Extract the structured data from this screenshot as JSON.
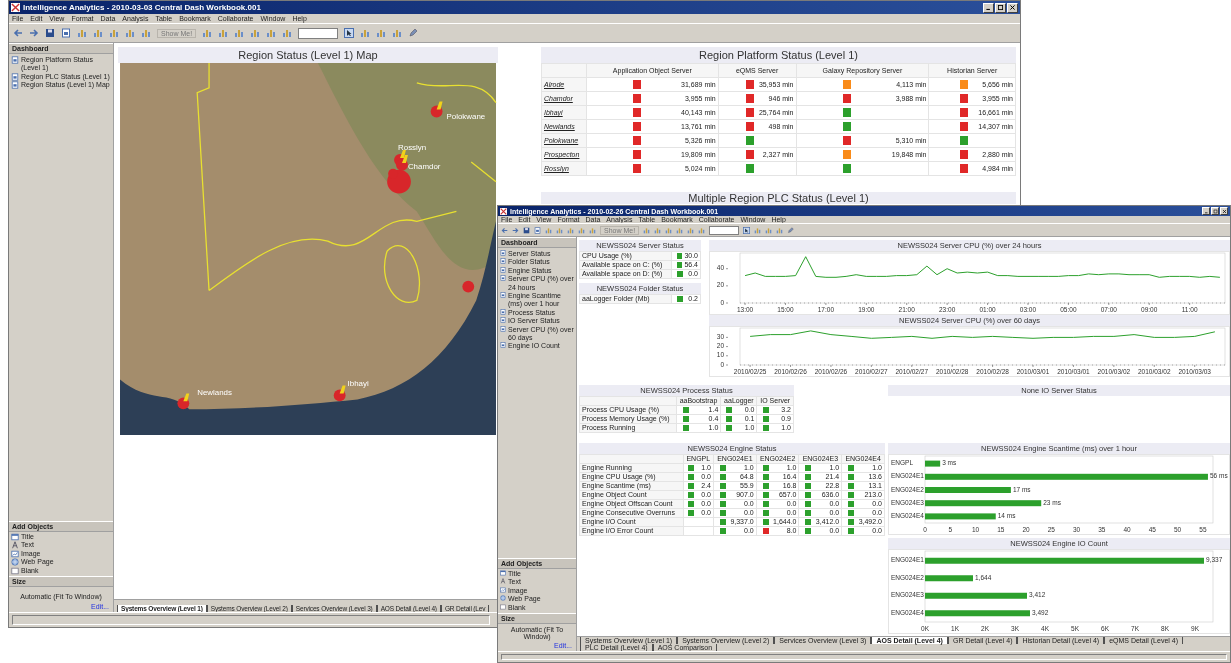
{
  "windows": [
    {
      "title": "Intelligence Analytics - 2010-03-03 Central Dash Workbook.001",
      "menu": [
        "File",
        "Edit",
        "View",
        "Format",
        "Data",
        "Analysis",
        "Table",
        "Bookmark",
        "Collaborate",
        "Window",
        "Help"
      ],
      "toolbar": {
        "show_me": "Show Me!"
      },
      "sidebar": {
        "dashboard_title": "Dashboard",
        "dashboard_items": [
          "Region Platform Status (Level 1)",
          "Region PLC Status (Level 1)",
          "Region Status (Level 1) Map"
        ],
        "add_objects_title": "Add Objects",
        "add_objects": [
          "Title",
          "Text",
          "Image",
          "Web Page",
          "Blank"
        ],
        "size_title": "Size",
        "size_value": "Automatic (Fit To Window)",
        "edit_link": "Edit..."
      },
      "panels": [
        {
          "kind": "map",
          "title": "Region Status (Level 1) Map",
          "pins": [
            {
              "label": "Polokwane"
            },
            {
              "label": "Rosslyn"
            },
            {
              "label": "Chamdor"
            },
            {
              "label": "Newlands"
            },
            {
              "label": "Ibhayi"
            }
          ]
        },
        {
          "kind": "status_table",
          "title": "Region Platform Status (Level 1)",
          "columns": [
            "Application Object Server",
            "eQMS Server",
            "Galaxy Repository Server",
            "Historian Server"
          ],
          "rows": [
            {
              "label": "Alrode",
              "link": true,
              "cells": [
                {
                  "color": "#e02828",
                  "value": "31,689 min"
                },
                {
                  "color": "#e02828",
                  "value": "35,953 min"
                },
                {
                  "color": "#f98b1a",
                  "value": "4,113 min"
                },
                {
                  "color": "#f98b1a",
                  "value": "5,656 min"
                }
              ]
            },
            {
              "label": "Chamdor",
              "link": true,
              "cells": [
                {
                  "color": "#e02828",
                  "value": "3,955 min"
                },
                {
                  "color": "#e02828",
                  "value": "946 min"
                },
                {
                  "color": "#e02828",
                  "value": "3,988 min"
                },
                {
                  "color": "#e02828",
                  "value": "3,955 min"
                }
              ]
            },
            {
              "label": "Ibhayi",
              "link": true,
              "cells": [
                {
                  "color": "#e02828",
                  "value": "40,143 min"
                },
                {
                  "color": "#e02828",
                  "value": "25,764 min"
                },
                {
                  "color": "#2ca02c"
                },
                {
                  "color": "#e02828",
                  "value": "16,661 min"
                }
              ]
            },
            {
              "label": "Newlands",
              "link": true,
              "cells": [
                {
                  "color": "#e02828",
                  "value": "13,761 min"
                },
                {
                  "color": "#e02828",
                  "value": "498 min"
                },
                {
                  "color": "#2ca02c"
                },
                {
                  "color": "#e02828",
                  "value": "14,307 min"
                }
              ]
            },
            {
              "label": "Polokwane",
              "link": true,
              "cells": [
                {
                  "color": "#e02828",
                  "value": "5,326 min"
                },
                {
                  "color": "#2ca02c"
                },
                {
                  "color": "#e02828",
                  "value": "5,310 min"
                },
                {
                  "color": "#2ca02c"
                }
              ]
            },
            {
              "label": "Prospecton",
              "link": true,
              "cells": [
                {
                  "color": "#e02828",
                  "value": "19,809 min"
                },
                {
                  "color": "#e02828",
                  "value": "2,327 min"
                },
                {
                  "color": "#f98b1a",
                  "value": "19,848 min"
                },
                {
                  "color": "#e02828",
                  "value": "2,880 min"
                }
              ]
            },
            {
              "label": "Rosslyn",
              "link": true,
              "cells": [
                {
                  "color": "#e02828",
                  "value": "5,024 min"
                },
                {
                  "color": "#2ca02c"
                },
                {
                  "color": "#2ca02c"
                },
                {
                  "color": "#e02828",
                  "value": "4,984 min"
                }
              ]
            }
          ]
        },
        {
          "kind": "status_table",
          "title": "Multiple Region PLC Status (Level 1)"
        }
      ],
      "tabs": [
        {
          "label": "Systems Overview (Level 1)",
          "selected": true
        },
        {
          "label": "Systems Overview (Level 2)",
          "selected": false
        },
        {
          "label": "Services Overview (Level 3)",
          "selected": false
        },
        {
          "label": "AOS Detail (Level 4)",
          "selected": false
        },
        {
          "label": "GR Detail (Lev",
          "selected": false
        }
      ]
    },
    {
      "title": "Intelligence Analytics - 2010-02-26 Central Dash Workbook.001",
      "menu": [
        "File",
        "Edit",
        "View",
        "Format",
        "Data",
        "Analysis",
        "Table",
        "Bookmark",
        "Collaborate",
        "Window",
        "Help"
      ],
      "toolbar": {
        "show_me": "Show Me!"
      },
      "sidebar": {
        "dashboard_title": "Dashboard",
        "dashboard_items": [
          "Server Status",
          "Folder Status",
          "Engine Status",
          "Server CPU (%) over 24 hours",
          "Engine Scantime (ms) over 1 hour",
          "Process Status",
          "IO Server Status",
          "Server CPU (%) over 60 days",
          "Engine IO Count"
        ],
        "add_objects_title": "Add Objects",
        "add_objects": [
          "Title",
          "Text",
          "Image",
          "Web Page",
          "Blank"
        ],
        "size_title": "Size",
        "size_value": "Automatic (Fit To Window)",
        "edit_link": "Edit..."
      },
      "panels": [
        {
          "kind": "status_table",
          "title": "NEWSS024 Server Status",
          "rows": [
            {
              "label": "CPU Usage (%)",
              "link": false,
              "cells": [
                {
                  "color": "#2ca02c",
                  "value": "30.0"
                }
              ]
            },
            {
              "label": "Available space on C: (%)",
              "link": false,
              "cells": [
                {
                  "color": "#2ca02c",
                  "value": "56.4"
                }
              ]
            },
            {
              "label": "Available space on D: (%)",
              "link": false,
              "cells": [
                {
                  "color": "#2ca02c",
                  "value": "0.0"
                }
              ]
            }
          ]
        },
        {
          "kind": "status_table",
          "title": "NEWSS024 Folder Status",
          "rows": [
            {
              "label": "aaLogger Folder (Mb)",
              "link": false,
              "cells": [
                {
                  "color": "#2ca02c",
                  "value": "0.2"
                }
              ]
            }
          ]
        },
        {
          "kind": "chart",
          "chart_data": {
            "type": "line",
            "title": "NEWSS024 Server CPU (%) over 24 hours",
            "ylim": [
              0,
              56
            ],
            "yticks": [
              0,
              20,
              40
            ],
            "categories": [
              "13:00",
              null,
              null,
              null,
              "15:00",
              null,
              null,
              null,
              "17:00",
              null,
              null,
              null,
              "19:00",
              null,
              null,
              null,
              "21:00",
              null,
              null,
              null,
              "23:00",
              null,
              null,
              null,
              "01:00",
              null,
              null,
              null,
              "03:00",
              null,
              null,
              null,
              "05:00",
              null,
              null,
              null,
              "07:00",
              null,
              null,
              null,
              "09:00",
              null,
              null,
              null,
              "11:00",
              null,
              null,
              null
            ],
            "series": [
              {
                "color": "#2ca02c",
                "values": [
                  32,
                  35,
                  31,
                  31,
                  31,
                  32,
                  54,
                  31,
                  30,
                  30,
                  31,
                  33,
                  31,
                  31,
                  31,
                  32,
                  32,
                  33,
                  43,
                  33,
                  40,
                  35,
                  36,
                  35,
                  36,
                  32,
                  32,
                  31,
                  31,
                  31,
                  31,
                  31,
                  32,
                  32,
                  34,
                  33,
                  34,
                  34,
                  33,
                  33,
                  33,
                  30,
                  31,
                  31,
                  31,
                  30,
                  31,
                  30
                ]
              }
            ]
          }
        },
        {
          "kind": "chart",
          "chart_data": {
            "type": "line",
            "title": "NEWSS024 Server CPU (%) over 60 days",
            "ylim": [
              0,
              38
            ],
            "yticks": [
              0,
              10,
              20,
              30
            ],
            "categories": [
              "2010/02/25",
              null,
              "2010/02/26",
              null,
              "2010/02/26",
              null,
              "2010/02/27",
              null,
              "2010/02/27",
              null,
              "2010/02/28",
              null,
              "2010/02/28",
              null,
              "2010/03/01",
              null,
              "2010/03/01",
              null,
              "2010/03/02",
              null,
              "2010/03/02",
              null,
              "2010/03/03",
              null
            ],
            "series": [
              {
                "color": "#2ca02c",
                "values": [
                  31,
                  33,
                  33,
                  37,
                  33,
                  31,
                  29,
                  30,
                  31,
                  29,
                  31,
                  30,
                  31,
                  30,
                  29,
                  30,
                  30,
                  31,
                  31,
                  33,
                  30,
                  30,
                  31,
                  36
                ]
              }
            ]
          }
        },
        {
          "kind": "status_table",
          "title": "NEWSS024 Process Status",
          "columns": [
            "aaBootstrap",
            "aaLogger",
            "IO Server"
          ],
          "rows": [
            {
              "label": "Process CPU Usage (%)",
              "link": false,
              "cells": [
                {
                  "color": "#2ca02c",
                  "value": "1.4"
                },
                {
                  "color": "#2ca02c",
                  "value": "0.0"
                },
                {
                  "color": "#2ca02c",
                  "value": "3.2"
                }
              ]
            },
            {
              "label": "Process Memory Usage (%)",
              "link": false,
              "cells": [
                {
                  "color": "#2ca02c",
                  "value": "0.4"
                },
                {
                  "color": "#2ca02c",
                  "value": "0.1"
                },
                {
                  "color": "#2ca02c",
                  "value": "0.9"
                }
              ]
            },
            {
              "label": "Process Running",
              "link": false,
              "cells": [
                {
                  "color": "#2ca02c",
                  "value": "1.0"
                },
                {
                  "color": "#2ca02c",
                  "value": "1.0"
                },
                {
                  "color": "#2ca02c",
                  "value": "1.0"
                }
              ]
            }
          ]
        },
        {
          "kind": "status_table",
          "title": "None IO Server Status"
        },
        {
          "kind": "status_table",
          "title": "NEWSS024 Engine Status",
          "columns": [
            "ENGPL",
            "ENG024E1",
            "ENG024E2",
            "ENG024E3",
            "ENG024E4"
          ],
          "rows": [
            {
              "label": "Engine Running",
              "link": false,
              "cells": [
                {
                  "color": "#2ca02c",
                  "value": "1.0"
                },
                {
                  "color": "#2ca02c",
                  "value": "1.0"
                },
                {
                  "color": "#2ca02c",
                  "value": "1.0"
                },
                {
                  "color": "#2ca02c",
                  "value": "1.0"
                },
                {
                  "color": "#2ca02c",
                  "value": "1.0"
                }
              ]
            },
            {
              "label": "Engine CPU Usage (%)",
              "link": false,
              "cells": [
                {
                  "color": "#2ca02c",
                  "value": "0.0"
                },
                {
                  "color": "#2ca02c",
                  "value": "64.8"
                },
                {
                  "color": "#2ca02c",
                  "value": "16.4"
                },
                {
                  "color": "#2ca02c",
                  "value": "21.4"
                },
                {
                  "color": "#2ca02c",
                  "value": "13.6"
                }
              ]
            },
            {
              "label": "Engine Scantime (ms)",
              "link": false,
              "cells": [
                {
                  "color": "#2ca02c",
                  "value": "2.4"
                },
                {
                  "color": "#2ca02c",
                  "value": "55.9"
                },
                {
                  "color": "#2ca02c",
                  "value": "16.8"
                },
                {
                  "color": "#2ca02c",
                  "value": "22.8"
                },
                {
                  "color": "#2ca02c",
                  "value": "13.1"
                }
              ]
            },
            {
              "label": "Engine Object Count",
              "link": false,
              "cells": [
                {
                  "color": "#2ca02c",
                  "value": "0.0"
                },
                {
                  "color": "#2ca02c",
                  "value": "907.0"
                },
                {
                  "color": "#2ca02c",
                  "value": "657.0"
                },
                {
                  "color": "#2ca02c",
                  "value": "636.0"
                },
                {
                  "color": "#2ca02c",
                  "value": "213.0"
                }
              ]
            },
            {
              "label": "Engine Object Offscan Count",
              "link": false,
              "cells": [
                {
                  "color": "#2ca02c",
                  "value": "0.0"
                },
                {
                  "color": "#2ca02c",
                  "value": "0.0"
                },
                {
                  "color": "#2ca02c",
                  "value": "0.0"
                },
                {
                  "color": "#2ca02c",
                  "value": "0.0"
                },
                {
                  "color": "#2ca02c",
                  "value": "0.0"
                }
              ]
            },
            {
              "label": "Engine Consecutive Overruns",
              "link": false,
              "cells": [
                {
                  "color": "#2ca02c",
                  "value": "0.0"
                },
                {
                  "color": "#2ca02c",
                  "value": "0.0"
                },
                {
                  "color": "#2ca02c",
                  "value": "0.0"
                },
                {
                  "color": "#2ca02c",
                  "value": "0.0"
                },
                {
                  "color": "#2ca02c",
                  "value": "0.0"
                }
              ]
            },
            {
              "label": "Engine I/O Count",
              "link": false,
              "cells": [
                null,
                {
                  "color": "#2ca02c",
                  "value": "9,337.0"
                },
                {
                  "color": "#2ca02c",
                  "value": "1,644.0"
                },
                {
                  "color": "#2ca02c",
                  "value": "3,412.0"
                },
                {
                  "color": "#2ca02c",
                  "value": "3,492.0"
                }
              ]
            },
            {
              "label": "Engine I/O Error Count",
              "link": false,
              "cells": [
                null,
                {
                  "color": "#2ca02c",
                  "value": "0.0"
                },
                {
                  "color": "#e02828",
                  "value": "8.0"
                },
                {
                  "color": "#2ca02c",
                  "value": "0.0"
                },
                {
                  "color": "#2ca02c",
                  "value": "0.0"
                }
              ]
            }
          ]
        },
        {
          "kind": "chart",
          "chart_data": {
            "type": "bar",
            "orientation": "horizontal",
            "title": "NEWSS024 Engine Scantime (ms) over 1 hour",
            "categories": [
              "ENGPL",
              "ENG024E1",
              "ENG024E2",
              "ENG024E3",
              "ENG024E4"
            ],
            "xlim": [
              0,
              57
            ],
            "xticks": [
              0,
              5,
              10,
              15,
              20,
              25,
              30,
              35,
              40,
              45,
              50,
              55
            ],
            "series": [
              {
                "color": "#2ca02c",
                "values": [
                  3,
                  56,
                  17,
                  23,
                  14
                ]
              }
            ],
            "value_labels": [
              "3 ms",
              "56 ms",
              "17 ms",
              "23 ms",
              "14 ms"
            ]
          }
        },
        {
          "kind": "chart",
          "chart_data": {
            "type": "bar",
            "orientation": "horizontal",
            "title": "NEWSS024 Engine IO Count",
            "categories": [
              "ENG024E1",
              "ENG024E2",
              "ENG024E3",
              "ENG024E4"
            ],
            "xlim": [
              0,
              9600
            ],
            "xticks": [
              {
                "value": 0,
                "label": "0K"
              },
              {
                "value": 1000,
                "label": "1K"
              },
              {
                "value": 2000,
                "label": "2K"
              },
              {
                "value": 3000,
                "label": "3K"
              },
              {
                "value": 4000,
                "label": "4K"
              },
              {
                "value": 5000,
                "label": "5K"
              },
              {
                "value": 6000,
                "label": "6K"
              },
              {
                "value": 7000,
                "label": "7K"
              },
              {
                "value": 8000,
                "label": "8K"
              },
              {
                "value": 9000,
                "label": "9K"
              }
            ],
            "series": [
              {
                "color": "#2ca02c",
                "values": [
                  9300,
                  1600,
                  3400,
                  3500
                ]
              }
            ],
            "value_labels": [
              "9,337",
              "1,644",
              "3,412",
              "3,492"
            ]
          }
        }
      ],
      "tabs": [
        {
          "label": "Systems Overview (Level 1)",
          "selected": false
        },
        {
          "label": "Systems Overview (Level 2)",
          "selected": false
        },
        {
          "label": "Services Overview (Level 3)",
          "selected": false
        },
        {
          "label": "AOS Detail (Level 4)",
          "selected": true
        },
        {
          "label": "GR Detail (Level 4)",
          "selected": false
        },
        {
          "label": "Historian Detail (Level 4)",
          "selected": false
        },
        {
          "label": "eQMS Detail (Level 4)",
          "selected": false
        },
        {
          "label": "PLC Detail (Level 4)",
          "selected": false
        },
        {
          "label": "AOS Comparison",
          "selected": false
        }
      ]
    }
  ]
}
